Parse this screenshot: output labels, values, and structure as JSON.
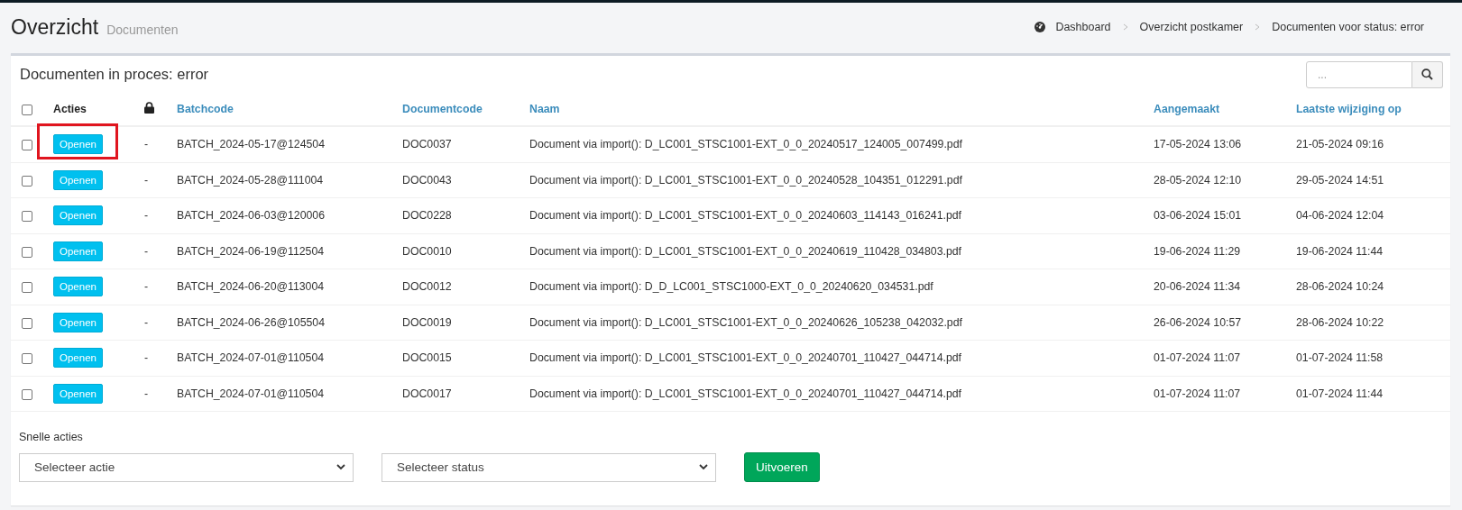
{
  "header": {
    "title": "Overzicht",
    "subtitle": "Documenten"
  },
  "breadcrumb": [
    {
      "label": "Dashboard",
      "kind": "home"
    },
    {
      "label": "Overzicht postkamer",
      "kind": "link"
    },
    {
      "label": "Documenten voor status: error",
      "kind": "current"
    }
  ],
  "card": {
    "title": "Documenten in proces: error",
    "search": {
      "placeholder": "..."
    }
  },
  "table": {
    "select_all": {
      "checked": false
    },
    "columns": [
      {
        "kind": "checkbox"
      },
      {
        "label": "Acties",
        "kind": "plain"
      },
      {
        "kind": "lock"
      },
      {
        "label": "Batchcode",
        "kind": "sortable"
      },
      {
        "label": "Documentcode",
        "kind": "sortable"
      },
      {
        "label": "Naam",
        "kind": "sortable"
      },
      {
        "label": "Aangemaakt",
        "kind": "sortable"
      },
      {
        "label": "Laatste wijziging op",
        "kind": "sortable"
      }
    ],
    "rows": [
      {
        "checked": false,
        "highlighted": true,
        "action": "Openen",
        "lock": "-",
        "batchcode": "BATCH_2024-05-17@124504",
        "documentcode": "DOC0037",
        "naam": "Document via import(): D_LC001_STSC1001-EXT_0_0_20240517_124005_007499.pdf",
        "aangemaakt": "17-05-2024 13:06",
        "gewijzigd": "21-05-2024 09:16"
      },
      {
        "checked": false,
        "highlighted": false,
        "action": "Openen",
        "lock": "-",
        "batchcode": "BATCH_2024-05-28@111004",
        "documentcode": "DOC0043",
        "naam": "Document via import(): D_LC001_STSC1001-EXT_0_0_20240528_104351_012291.pdf",
        "aangemaakt": "28-05-2024 12:10",
        "gewijzigd": "29-05-2024 14:51"
      },
      {
        "checked": false,
        "highlighted": false,
        "action": "Openen",
        "lock": "-",
        "batchcode": "BATCH_2024-06-03@120006",
        "documentcode": "DOC0228",
        "naam": "Document via import(): D_LC001_STSC1001-EXT_0_0_20240603_114143_016241.pdf",
        "aangemaakt": "03-06-2024 15:01",
        "gewijzigd": "04-06-2024 12:04"
      },
      {
        "checked": false,
        "highlighted": false,
        "action": "Openen",
        "lock": "-",
        "batchcode": "BATCH_2024-06-19@112504",
        "documentcode": "DOC0010",
        "naam": "Document via import(): D_LC001_STSC1001-EXT_0_0_20240619_110428_034803.pdf",
        "aangemaakt": "19-06-2024 11:29",
        "gewijzigd": "19-06-2024 11:44"
      },
      {
        "checked": false,
        "highlighted": false,
        "action": "Openen",
        "lock": "-",
        "batchcode": "BATCH_2024-06-20@113004",
        "documentcode": "DOC0012",
        "naam": "Document via import(): D_D_LC001_STSC1000-EXT_0_0_20240620_034531.pdf",
        "aangemaakt": "20-06-2024 11:34",
        "gewijzigd": "28-06-2024 10:24"
      },
      {
        "checked": false,
        "highlighted": false,
        "action": "Openen",
        "lock": "-",
        "batchcode": "BATCH_2024-06-26@105504",
        "documentcode": "DOC0019",
        "naam": "Document via import(): D_LC001_STSC1001-EXT_0_0_20240626_105238_042032.pdf",
        "aangemaakt": "26-06-2024 10:57",
        "gewijzigd": "28-06-2024 10:22"
      },
      {
        "checked": false,
        "highlighted": false,
        "action": "Openen",
        "lock": "-",
        "batchcode": "BATCH_2024-07-01@110504",
        "documentcode": "DOC0015",
        "naam": "Document via import(): D_LC001_STSC1001-EXT_0_0_20240701_110427_044714.pdf",
        "aangemaakt": "01-07-2024 11:07",
        "gewijzigd": "01-07-2024 11:58"
      },
      {
        "checked": false,
        "highlighted": false,
        "action": "Openen",
        "lock": "-",
        "batchcode": "BATCH_2024-07-01@110504",
        "documentcode": "DOC0017",
        "naam": "Document via import(): D_LC001_STSC1001-EXT_0_0_20240701_110427_044714.pdf",
        "aangemaakt": "01-07-2024 11:07",
        "gewijzigd": "01-07-2024 11:44"
      }
    ]
  },
  "quick_actions": {
    "label": "Snelle acties",
    "selects": [
      {
        "value": "Selecteer actie"
      },
      {
        "value": "Selecteer status"
      }
    ],
    "button": "Uitvoeren"
  }
}
